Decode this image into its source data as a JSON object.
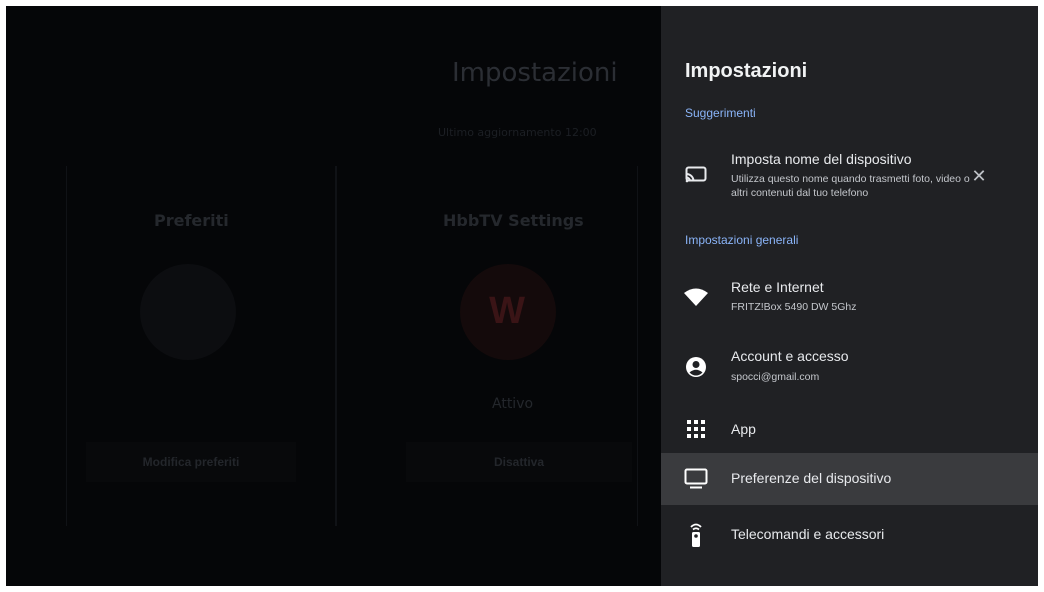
{
  "background_app": {
    "title": "Impostazioni",
    "subtitle": "Ultimo aggiornamento 12:00",
    "favorites_title": "Preferiti",
    "hbbtv_title": "HbbTV Settings",
    "hbbtv_logo": "W",
    "hbbtv_status": "Attivo",
    "edit_favorites_label": "Modifica preferiti",
    "disable_label": "Disattiva"
  },
  "panel": {
    "title": "Impostazioni",
    "suggestions_label": "Suggerimenti",
    "device_name": {
      "title": "Imposta nome del dispositivo",
      "subtitle": "Utilizza questo nome quando trasmetti foto, video o altri contenuti dal tuo telefono",
      "icon": "cast-icon",
      "dismiss": "✕"
    },
    "general_label": "Impostazioni generali",
    "items": [
      {
        "title": "Rete e Internet",
        "subtitle": "FRITZ!Box 5490 DW 5Ghz",
        "icon": "wifi-icon"
      },
      {
        "title": "Account e accesso",
        "subtitle": "spocci@gmail.com",
        "icon": "account-icon"
      },
      {
        "title": "App",
        "icon": "apps-grid-icon"
      },
      {
        "title": "Preferenze del dispositivo",
        "icon": "tv-icon",
        "selected": true
      },
      {
        "title": "Telecomandi e accessori",
        "icon": "remote-icon"
      }
    ]
  },
  "colors": {
    "panel_bg": "#202124",
    "selected_bg": "#3a3b3e",
    "section_label": "#8ab4f8",
    "text": "#e8eaed"
  }
}
